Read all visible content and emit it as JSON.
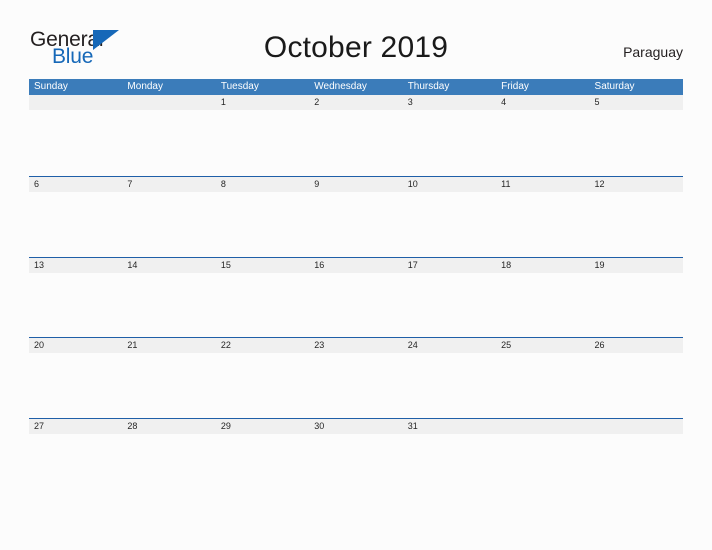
{
  "logo": {
    "word1": "General",
    "word2": "Blue",
    "triangle_color": "#1668b8",
    "word1_color": "#231f20",
    "word2_color": "#1668b8"
  },
  "header": {
    "title": "October 2019",
    "region": "Paraguay"
  },
  "colors": {
    "header_blue": "#3b7cba",
    "rule_blue": "#1f5fa8",
    "band_gray": "#f0f0f0",
    "page_background": "#fcfcfc",
    "text_dark": "#262626"
  },
  "calendar": {
    "month": "October",
    "year": "2019",
    "day_headers": [
      "Sunday",
      "Monday",
      "Tuesday",
      "Wednesday",
      "Thursday",
      "Friday",
      "Saturday"
    ],
    "weeks": [
      [
        "",
        "",
        "1",
        "2",
        "3",
        "4",
        "5"
      ],
      [
        "6",
        "7",
        "8",
        "9",
        "10",
        "11",
        "12"
      ],
      [
        "13",
        "14",
        "15",
        "16",
        "17",
        "18",
        "19"
      ],
      [
        "20",
        "21",
        "22",
        "23",
        "24",
        "25",
        "26"
      ],
      [
        "27",
        "28",
        "29",
        "30",
        "31",
        "",
        ""
      ]
    ]
  }
}
